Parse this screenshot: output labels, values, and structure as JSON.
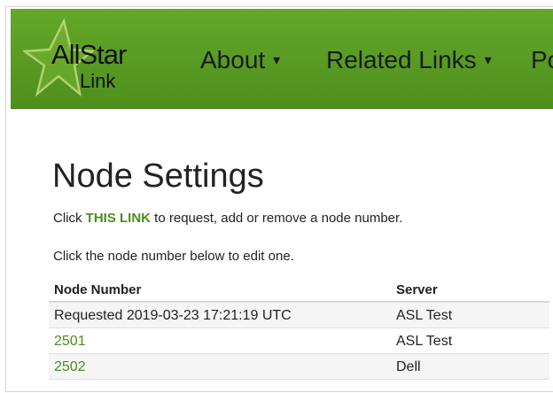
{
  "brand": {
    "logo_top": "AllStar",
    "logo_bottom": "Link"
  },
  "nav": {
    "items": [
      {
        "label": "About",
        "caret": "▾"
      },
      {
        "label": "Related Links",
        "caret": "▾"
      },
      {
        "label": "Po"
      }
    ]
  },
  "page": {
    "title": "Node Settings",
    "instruction1": {
      "prefix": "Click ",
      "link": "THIS LINK",
      "suffix": " to request, add or remove a node number."
    },
    "instruction2": "Click the node number below to edit one."
  },
  "table": {
    "headers": [
      "Node Number",
      "Server"
    ],
    "rows": [
      {
        "node": "Requested 2019-03-23 17:21:19 UTC",
        "server": "ASL Test",
        "link": false
      },
      {
        "node": "2501",
        "server": "ASL Test",
        "link": true
      },
      {
        "node": "2502",
        "server": "Dell",
        "link": true
      }
    ]
  },
  "colors": {
    "navbar": "#5a9e24",
    "link": "#4a8f1d"
  }
}
